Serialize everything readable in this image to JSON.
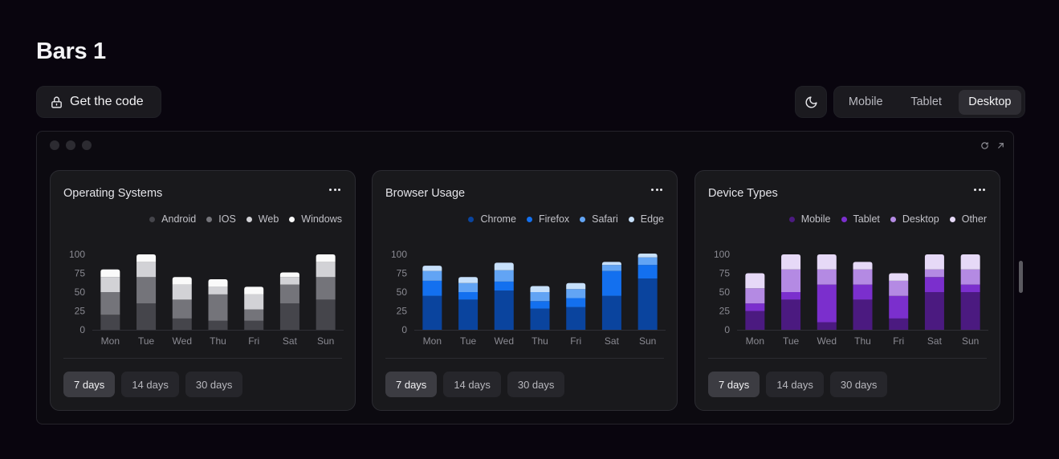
{
  "page": {
    "title": "Bars 1"
  },
  "toolbar": {
    "get_code_label": "Get the code",
    "viewports": [
      {
        "label": "Mobile",
        "active": false
      },
      {
        "label": "Tablet",
        "active": false
      },
      {
        "label": "Desktop",
        "active": true
      }
    ]
  },
  "colors": {
    "background": "#09050e",
    "card": "#19191c",
    "active_button": "#3c3c42"
  },
  "cards": [
    {
      "title": "Operating Systems",
      "legend": [
        "Android",
        "IOS",
        "Web",
        "Windows"
      ],
      "ranges": [
        {
          "label": "7 days",
          "active": true
        },
        {
          "label": "14 days",
          "active": false
        },
        {
          "label": "30 days",
          "active": false
        }
      ]
    },
    {
      "title": "Browser Usage",
      "legend": [
        "Chrome",
        "Firefox",
        "Safari",
        "Edge"
      ],
      "ranges": [
        {
          "label": "7 days",
          "active": true
        },
        {
          "label": "14 days",
          "active": false
        },
        {
          "label": "30 days",
          "active": false
        }
      ]
    },
    {
      "title": "Device Types",
      "legend": [
        "Mobile",
        "Tablet",
        "Desktop",
        "Other"
      ],
      "ranges": [
        {
          "label": "7 days",
          "active": true
        },
        {
          "label": "14 days",
          "active": false
        },
        {
          "label": "30 days",
          "active": false
        }
      ]
    }
  ],
  "chart_data": [
    {
      "type": "bar",
      "stacked": true,
      "categories": [
        "Mon",
        "Tue",
        "Wed",
        "Thu",
        "Fri",
        "Sat",
        "Sun"
      ],
      "yticks": [
        0,
        25,
        50,
        75,
        100
      ],
      "ylim": [
        0,
        100
      ],
      "grid": false,
      "legend_position": "top-right",
      "series": [
        {
          "name": "Android",
          "color": "#45454b",
          "values": [
            20,
            35,
            15,
            12,
            12,
            35,
            40
          ]
        },
        {
          "name": "IOS",
          "color": "#74747a",
          "values": [
            30,
            35,
            25,
            35,
            15,
            25,
            30
          ]
        },
        {
          "name": "Web",
          "color": "#d2d2d6",
          "values": [
            20,
            20,
            20,
            10,
            20,
            10,
            20
          ]
        },
        {
          "name": "Windows",
          "color": "#fafafa",
          "values": [
            10,
            10,
            10,
            10,
            10,
            6,
            10
          ]
        }
      ]
    },
    {
      "type": "bar",
      "stacked": true,
      "categories": [
        "Mon",
        "Tue",
        "Wed",
        "Thu",
        "Fri",
        "Sat",
        "Sun"
      ],
      "yticks": [
        0,
        25,
        50,
        75,
        100
      ],
      "ylim": [
        0,
        100
      ],
      "grid": false,
      "legend_position": "top-right",
      "series": [
        {
          "name": "Chrome",
          "color": "#0a449e",
          "values": [
            45,
            40,
            52,
            28,
            30,
            45,
            68
          ]
        },
        {
          "name": "Firefox",
          "color": "#1370ef",
          "values": [
            20,
            10,
            12,
            10,
            12,
            33,
            18
          ]
        },
        {
          "name": "Safari",
          "color": "#62a4f4",
          "values": [
            13,
            12,
            15,
            12,
            12,
            8,
            10
          ]
        },
        {
          "name": "Edge",
          "color": "#c7e0fb",
          "values": [
            7,
            8,
            10,
            8,
            8,
            4,
            5
          ]
        }
      ]
    },
    {
      "type": "bar",
      "stacked": true,
      "categories": [
        "Mon",
        "Tue",
        "Wed",
        "Thu",
        "Fri",
        "Sat",
        "Sun"
      ],
      "yticks": [
        0,
        25,
        50,
        75,
        100
      ],
      "ylim": [
        0,
        100
      ],
      "grid": false,
      "legend_position": "top-right",
      "series": [
        {
          "name": "Mobile",
          "color": "#4b1a80",
          "values": [
            25,
            40,
            10,
            40,
            15,
            50,
            50
          ]
        },
        {
          "name": "Tablet",
          "color": "#7b2fcd",
          "values": [
            10,
            10,
            50,
            20,
            30,
            20,
            10
          ]
        },
        {
          "name": "Desktop",
          "color": "#b48ae3",
          "values": [
            20,
            30,
            20,
            20,
            20,
            10,
            20
          ]
        },
        {
          "name": "Other",
          "color": "#e6d9f7",
          "values": [
            20,
            20,
            20,
            10,
            10,
            20,
            20
          ]
        }
      ]
    }
  ]
}
